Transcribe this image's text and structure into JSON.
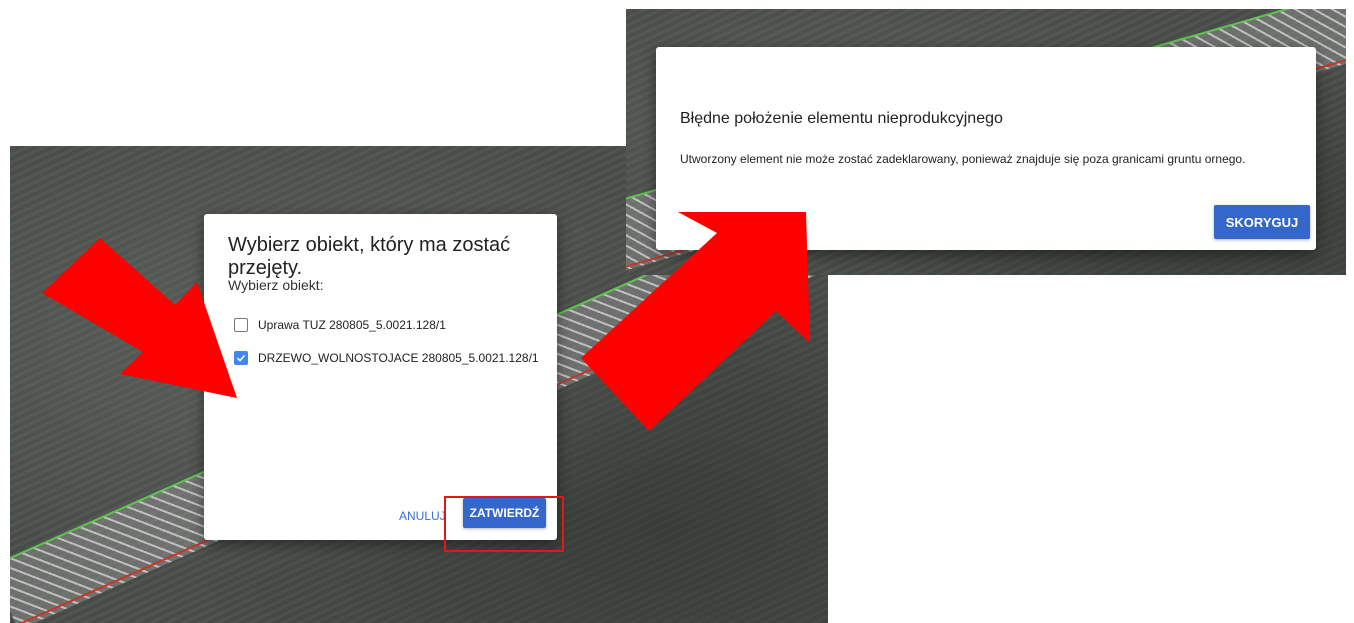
{
  "dialog_select": {
    "title": "Wybierz obiekt, który ma zostać przejęty.",
    "subtitle": "Wybierz obiekt:",
    "options": [
      {
        "label": "Uprawa TUZ 280805_5.0021.128/1",
        "checked": false
      },
      {
        "label": "DRZEWO_WOLNOSTOJACE 280805_5.0021.128/1",
        "checked": true
      }
    ],
    "cancel_label": "ANULUJ",
    "confirm_label": "ZATWIERDŹ"
  },
  "dialog_error": {
    "title": "Błędne położenie elementu nieprodukcyjnego",
    "message": "Utworzony element nie może zostać zadeklarowany, ponieważ znajduje się poza granicami gruntu ornego.",
    "correct_label": "SKORYGUJ"
  },
  "colors": {
    "primary_button": "#3467c9",
    "checkbox_checked": "#4285f4",
    "annotation_red": "#e01818",
    "arrow_red": "#ff0000"
  }
}
